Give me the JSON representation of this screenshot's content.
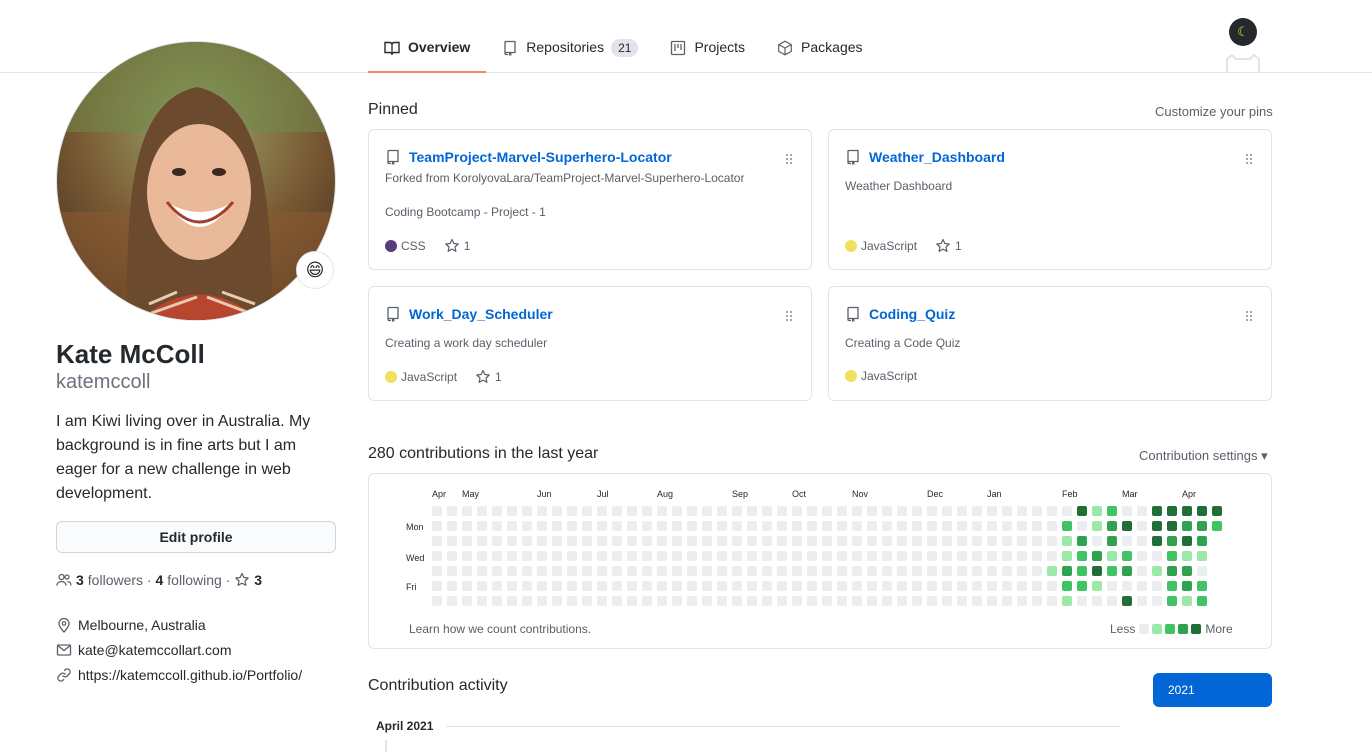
{
  "tabs": [
    {
      "label": "Overview",
      "counter": null
    },
    {
      "label": "Repositories",
      "counter": "21"
    },
    {
      "label": "Projects",
      "counter": null
    },
    {
      "label": "Packages",
      "counter": null
    }
  ],
  "theme_icon": "moon-icon",
  "profile": {
    "status_emoji": "😄",
    "name": "Kate McColl",
    "login": "katemccoll",
    "bio": "I am Kiwi living over in Australia. My background is in fine arts but I am eager for a new challenge in web development.",
    "edit_label": "Edit profile",
    "followers_count": "3",
    "followers_label": "followers",
    "following_count": "4",
    "following_label": "following",
    "stars_count": "3",
    "location": "Melbourne, Australia",
    "email": "kate@katemccollart.com",
    "website": "https://katemccoll.github.io/Portfolio/"
  },
  "pinned": {
    "title": "Pinned",
    "customize": "Customize your pins",
    "cards": [
      {
        "name": "TeamProject-Marvel-Superhero-Locator",
        "forked": "Forked from KorolyovaLara/TeamProject-Marvel-Superhero-Locator",
        "description": "Coding Bootcamp - Project - 1",
        "language": "CSS",
        "lang_color": "#563d7c",
        "stars": "1"
      },
      {
        "name": "Weather_Dashboard",
        "forked": "",
        "description": "Weather Dashboard",
        "language": "JavaScript",
        "lang_color": "#f1e05a",
        "stars": "1"
      },
      {
        "name": "Work_Day_Scheduler",
        "forked": "",
        "description": "Creating a work day scheduler",
        "language": "JavaScript",
        "lang_color": "#f1e05a",
        "stars": "1"
      },
      {
        "name": "Coding_Quiz",
        "forked": "",
        "description": "Creating a Code Quiz",
        "language": "JavaScript",
        "lang_color": "#f1e05a",
        "stars": ""
      }
    ]
  },
  "contributions": {
    "title": "280 contributions in the last year",
    "settings": "Contribution settings",
    "months": [
      "Apr",
      "May",
      "Jun",
      "Jul",
      "Aug",
      "Sep",
      "Oct",
      "Nov",
      "Dec",
      "Jan",
      "Feb",
      "Mar",
      "Apr"
    ],
    "days": [
      "Mon",
      "Wed",
      "Fri"
    ],
    "learn": "Learn how we count contributions.",
    "less": "Less",
    "more": "More",
    "level_colors": [
      "#ebedf0",
      "#9be9a8",
      "#40c463",
      "#30a14e",
      "#216e39"
    ],
    "weeks_count": 53,
    "tail_levels": [
      [
        0,
        0,
        0,
        0,
        1,
        0,
        0
      ],
      [
        0,
        2,
        1,
        1,
        3,
        2,
        1
      ],
      [
        4,
        0,
        3,
        2,
        2,
        2,
        0
      ],
      [
        1,
        1,
        0,
        3,
        4,
        1,
        0
      ],
      [
        2,
        3,
        3,
        1,
        2,
        0,
        0
      ],
      [
        0,
        4,
        0,
        2,
        3,
        0,
        4
      ],
      [
        0,
        0,
        0,
        0,
        0,
        0,
        0
      ],
      [
        4,
        4,
        4,
        0,
        1,
        0,
        0
      ],
      [
        4,
        4,
        3,
        2,
        3,
        2,
        2
      ],
      [
        4,
        3,
        4,
        1,
        3,
        3,
        1
      ],
      [
        4,
        3,
        3,
        1,
        0,
        2,
        2
      ],
      [
        4,
        2,
        0,
        0,
        0,
        0,
        0
      ]
    ]
  },
  "activity": {
    "title": "Contribution activity",
    "year": "2021",
    "month_heading": "April 2021"
  }
}
